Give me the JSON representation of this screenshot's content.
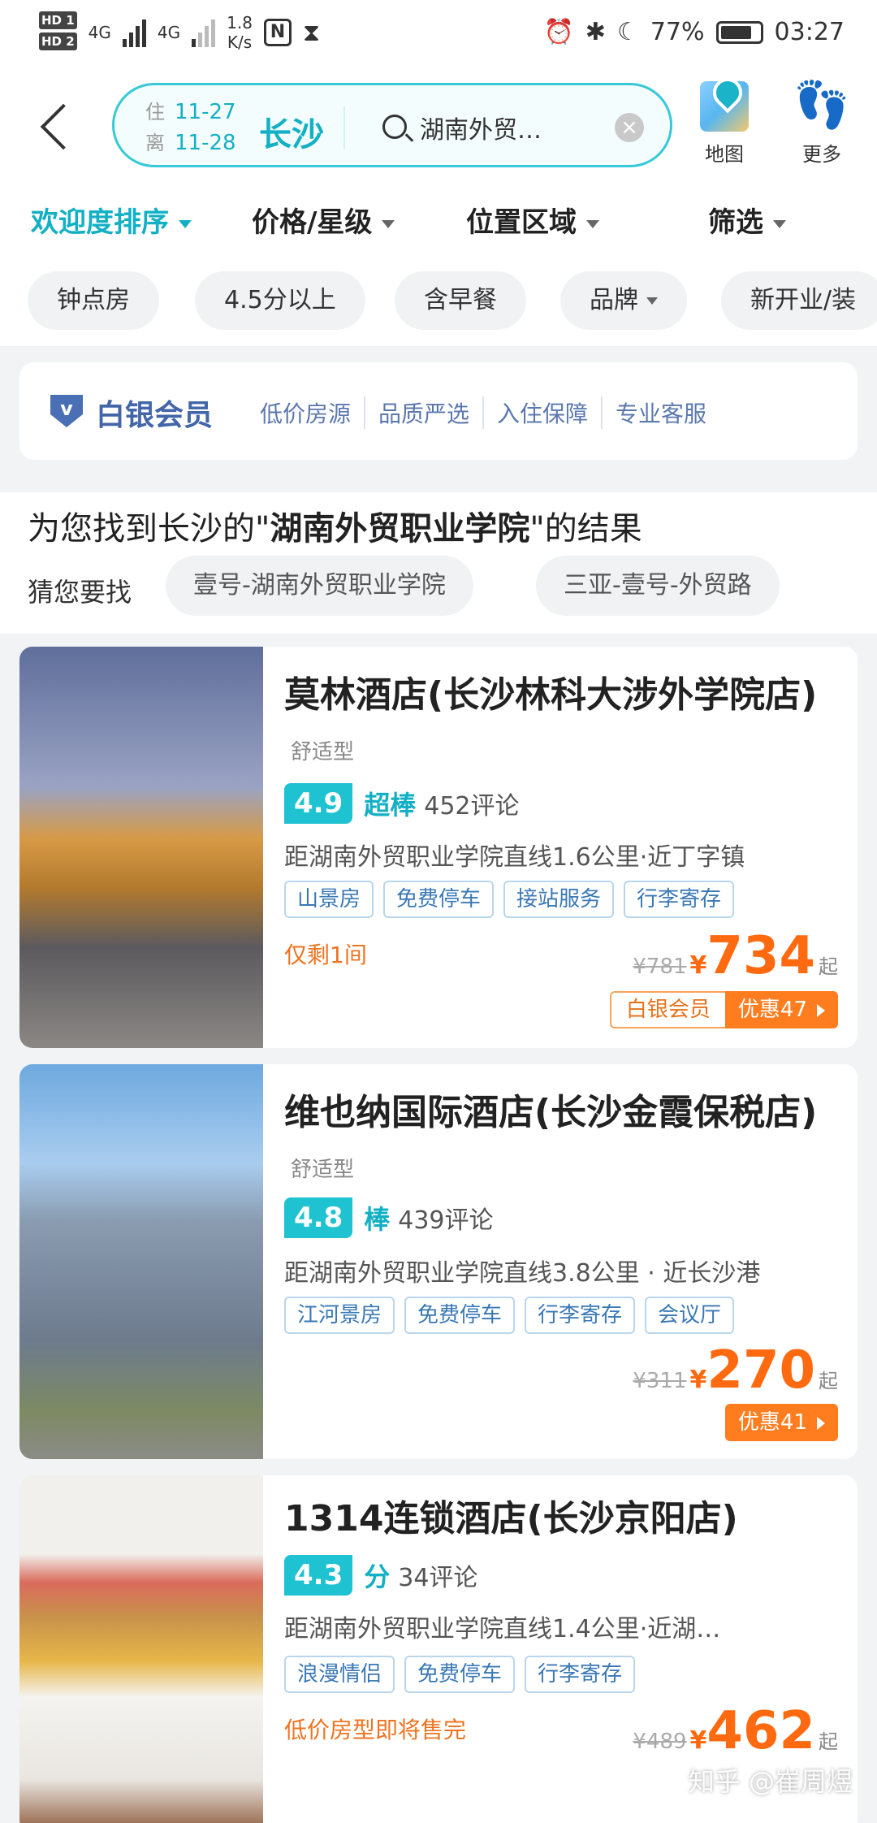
{
  "status_bar": {
    "hd1": "HD 1",
    "hd2": "HD 2",
    "net1": "4G",
    "net2": "4G",
    "speed_value": "1.8",
    "speed_unit": "K/s",
    "nfc": "N",
    "battery": "77%",
    "time": "03:27"
  },
  "header": {
    "checkin_label": "住",
    "checkin_date": "11-27",
    "checkout_label": "离",
    "checkout_date": "11-28",
    "city": "长沙",
    "keyword": "湖南外贸…",
    "map_label": "地图",
    "more_label": "更多"
  },
  "sort_bar": [
    {
      "label": "欢迎度排序",
      "active": true
    },
    {
      "label": "价格/星级"
    },
    {
      "label": "位置区域"
    },
    {
      "label": "筛选"
    }
  ],
  "chips": [
    "钟点房",
    "4.5分以上",
    "含早餐",
    "品牌",
    "新开业/装"
  ],
  "member": {
    "title": "白银会员",
    "perks": [
      "低价房源",
      "品质严选",
      "入住保障",
      "专业客服"
    ]
  },
  "result": {
    "prefix": "为您找到长沙的\"",
    "keyword": "湖南外贸职业学院",
    "suffix": "\"的结果",
    "guess_label": "猜您要找",
    "suggestions": [
      "壹号-湖南外贸职业学院",
      "三亚-壹号-外贸路"
    ]
  },
  "hotels": [
    {
      "name": "莫林酒店(长沙林科大涉外学院店)",
      "type": "舒适型",
      "score": "4.9",
      "score_label": "超棒",
      "reviews": "452评论",
      "distance": "距湖南外贸职业学院直线1.6公里·近丁字镇",
      "tags": [
        "山景房",
        "免费停车",
        "接站服务",
        "行李寄存"
      ],
      "note": "仅剩1间",
      "old_price": "¥781",
      "currency": "¥",
      "price": "734",
      "price_suffix": "起",
      "member_badge": "白银会员",
      "discount": "优惠47"
    },
    {
      "name": "维也纳国际酒店(长沙金霞保税店)",
      "type": "舒适型",
      "score": "4.8",
      "score_label": "棒",
      "reviews": "439评论",
      "distance": "距湖南外贸职业学院直线3.8公里 · 近长沙港",
      "tags": [
        "江河景房",
        "免费停车",
        "行李寄存",
        "会议厅"
      ],
      "old_price": "¥311",
      "currency": "¥",
      "price": "270",
      "price_suffix": "起",
      "discount": "优惠41"
    },
    {
      "name": "1314连锁酒店(长沙京阳店)",
      "score": "4.3",
      "score_label": "分",
      "reviews": "34评论",
      "distance": "距湖南外贸职业学院直线1.4公里·近湖…",
      "tags": [
        "浪漫情侣",
        "免费停车",
        "行李寄存"
      ],
      "note": "低价房型即将售完",
      "old_price": "¥489",
      "currency": "¥",
      "price": "462",
      "price_suffix": "起"
    }
  ],
  "watermark": "知乎 @崔周煜",
  "colors": {
    "accent": "#13b0c5",
    "price": "#ff6a10",
    "member": "#4366a8"
  }
}
